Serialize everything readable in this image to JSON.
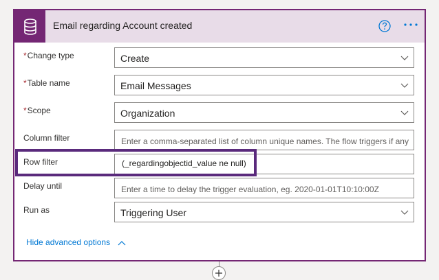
{
  "card": {
    "title": "Email regarding Account created",
    "icon": "database-icon",
    "accent_color": "#742774",
    "header_bg": "#e8dce8"
  },
  "fields": {
    "change_type": {
      "label": "Change type",
      "required": true,
      "value": "Create"
    },
    "table_name": {
      "label": "Table name",
      "required": true,
      "value": "Email Messages"
    },
    "scope": {
      "label": "Scope",
      "required": true,
      "value": "Organization"
    },
    "column_filter": {
      "label": "Column filter",
      "placeholder": "Enter a comma-separated list of column unique names. The flow triggers if any"
    },
    "row_filter": {
      "label": "Row filter",
      "value": "(_regardingobjectid_value ne null)"
    },
    "delay_until": {
      "label": "Delay until",
      "placeholder": "Enter a time to delay the trigger evaluation, eg. 2020-01-01T10:10:00Z"
    },
    "run_as": {
      "label": "Run as",
      "value": "Triggering User"
    }
  },
  "required_marker": "*",
  "advanced_toggle": "Hide advanced options",
  "highlight_color": "#5a2a7c",
  "link_color": "#0078d4"
}
